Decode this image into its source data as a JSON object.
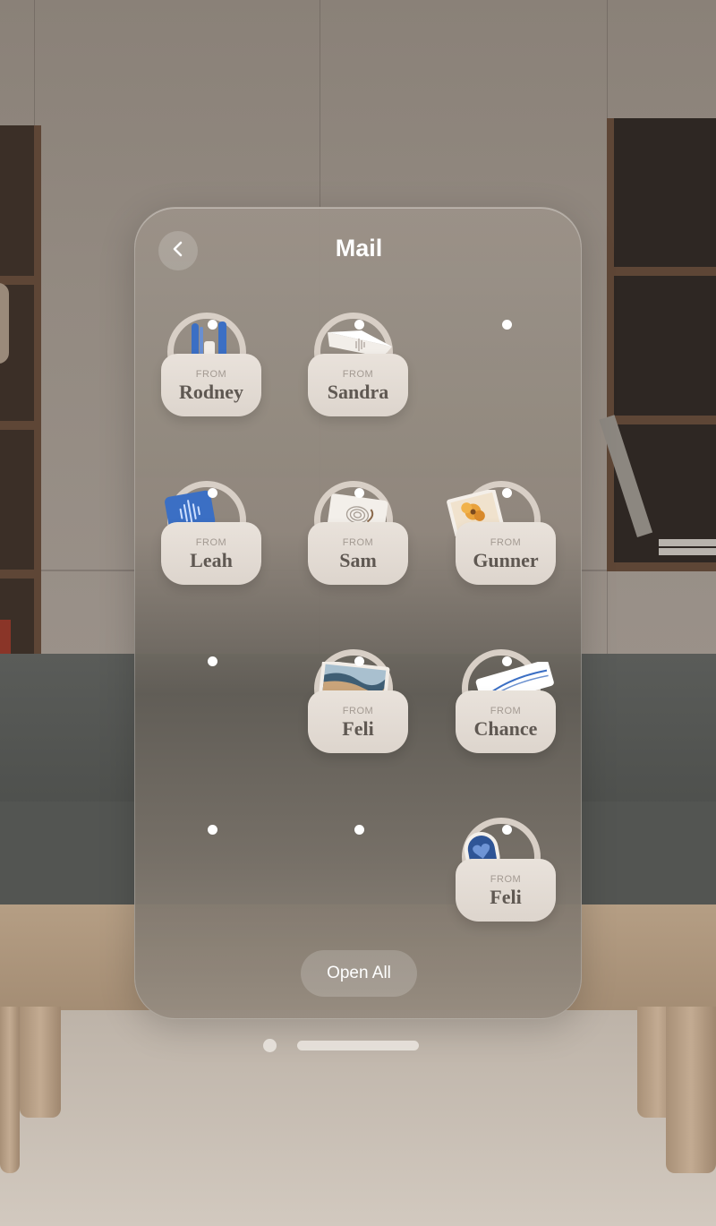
{
  "window": {
    "title": "Mail",
    "back_icon": "chevron-left-icon",
    "open_all_label": "Open All"
  },
  "mail": {
    "from_label": "FROM",
    "rows": [
      [
        {
          "sender": "Rodney",
          "item": "blue-tools-icon"
        },
        {
          "sender": "Sandra",
          "item": "paper-note-icon"
        },
        null
      ],
      [
        {
          "sender": "Leah",
          "item": "voice-card-icon"
        },
        {
          "sender": "Sam",
          "item": "fingerprint-card-icon"
        },
        {
          "sender": "Gunner",
          "item": "flower-photo-icon"
        }
      ],
      [
        null,
        {
          "sender": "Feli",
          "item": "landscape-photo-icon"
        },
        {
          "sender": "Chance",
          "item": "creativity-card-icon"
        }
      ],
      [
        null,
        null,
        {
          "sender": "Feli",
          "item": "heart-card-icon"
        }
      ]
    ]
  },
  "colors": {
    "pocket": "#e6dfd8",
    "name_text": "#5f5852",
    "from_text": "#a39a92",
    "accent_blue": "#3b6fc4"
  },
  "controls": {
    "close_icon": "window-close-dot",
    "bar_icon": "window-grab-bar"
  }
}
